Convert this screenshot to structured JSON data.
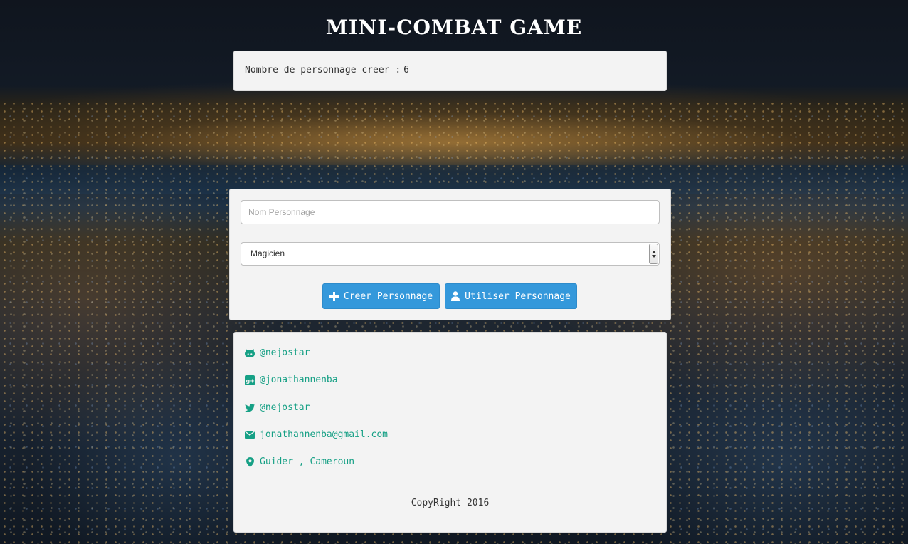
{
  "page": {
    "title": "MINI-COMBAT GAME"
  },
  "counter": {
    "label": "Nombre de personnage creer :",
    "value": "6"
  },
  "form": {
    "name_placeholder": "Nom Personnage",
    "name_value": "",
    "class_selected": "Magicien",
    "create_button": "Creer Personnage",
    "use_button": "Utiliser Personnage"
  },
  "contacts": {
    "github": "@nejostar",
    "google_plus": "@jonathannenba",
    "twitter": "@nejostar",
    "email": "jonathannenba@gmail.com",
    "location": "Guider , Cameroun"
  },
  "footer": {
    "copyright": "CopyRight 2016"
  },
  "colors": {
    "accent_button": "#3498db",
    "link_green": "#16a085",
    "panel_bg": "#f3f3f3"
  },
  "icons": {
    "create": "plus-icon",
    "use": "user-icon",
    "github": "github-icon",
    "google_plus": "google-plus-icon",
    "twitter": "twitter-icon",
    "email": "envelope-icon",
    "location": "map-marker-icon"
  }
}
